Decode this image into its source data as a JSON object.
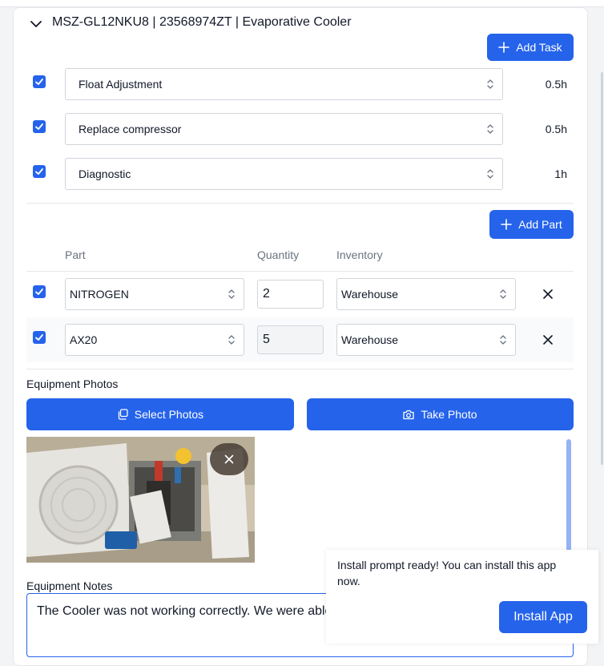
{
  "header": {
    "title": "MSZ-GL12NKU8 | 23568974ZT | Evaporative Cooler"
  },
  "tasks": {
    "add_label": "Add Task",
    "items": [
      {
        "name": "Float Adjustment",
        "hours": "0.5h",
        "checked": true
      },
      {
        "name": "Replace compressor",
        "hours": "0.5h",
        "checked": true
      },
      {
        "name": "Diagnostic",
        "hours": "1h",
        "checked": true
      }
    ]
  },
  "parts": {
    "add_label": "Add Part",
    "columns": {
      "part": "Part",
      "quantity": "Quantity",
      "inventory": "Inventory"
    },
    "rows": [
      {
        "part": "NITROGEN",
        "quantity": "2",
        "inventory": "Warehouse",
        "checked": true
      },
      {
        "part": "AX20",
        "quantity": "5",
        "inventory": "Warehouse",
        "checked": true
      }
    ]
  },
  "photos": {
    "label": "Equipment Photos",
    "select_label": "Select Photos",
    "take_label": "Take Photo"
  },
  "notes": {
    "label": "Equipment Notes",
    "value": "The Cooler was not working correctly. We were able to fix it"
  },
  "install_prompt": {
    "message": "Install prompt ready! You can install this app now.",
    "button_label": "Install App"
  },
  "colors": {
    "accent": "#2563eb"
  }
}
